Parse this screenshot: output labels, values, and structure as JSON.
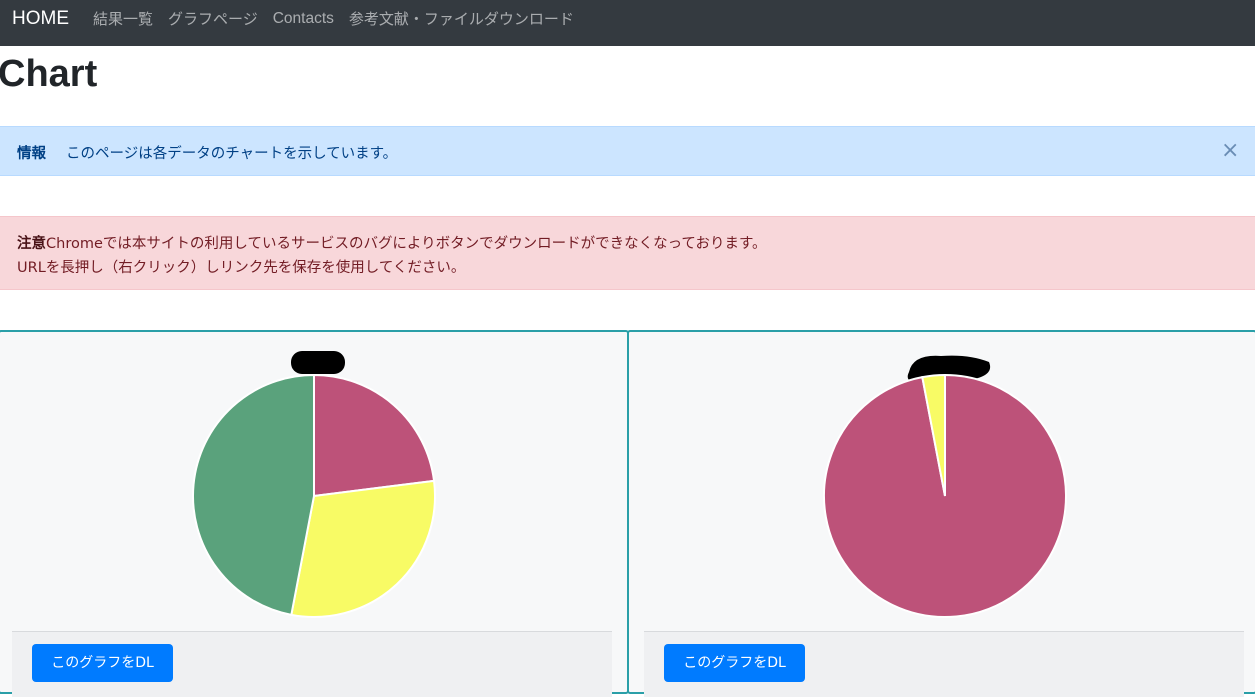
{
  "navbar": {
    "brand": "HOME",
    "links": [
      "結果一覧",
      "グラフページ",
      "Contacts",
      "参考文献・ファイルダウンロード"
    ]
  },
  "page": {
    "title": "Chart"
  },
  "alert_info": {
    "label": "情報",
    "message": "このページは各データのチャートを示しています。",
    "close": "×"
  },
  "alert_danger": {
    "label": "注意",
    "line1": "Chromeでは本サイトの利用しているサービスのバグによりボタンでダウンロードができなくなっております。",
    "line2": "URLを長押し（右クリック）しリンク先を保存を使用してください。"
  },
  "colors": {
    "slice_red": "#bd5279",
    "slice_yellow": "#f8fb65",
    "slice_green": "#5aa27c",
    "card_border": "#2a9fa8",
    "button": "#007bff"
  },
  "chart_data": [
    {
      "type": "pie",
      "title": "",
      "values": [
        23,
        30,
        47
      ],
      "colors": [
        "#bd5279",
        "#f8fb65",
        "#5aa27c"
      ],
      "download_label": "このグラフをDL"
    },
    {
      "type": "pie",
      "title": "",
      "values": [
        97,
        3
      ],
      "colors": [
        "#bd5279",
        "#f8fb65"
      ],
      "download_label": "このグラフをDL"
    }
  ]
}
